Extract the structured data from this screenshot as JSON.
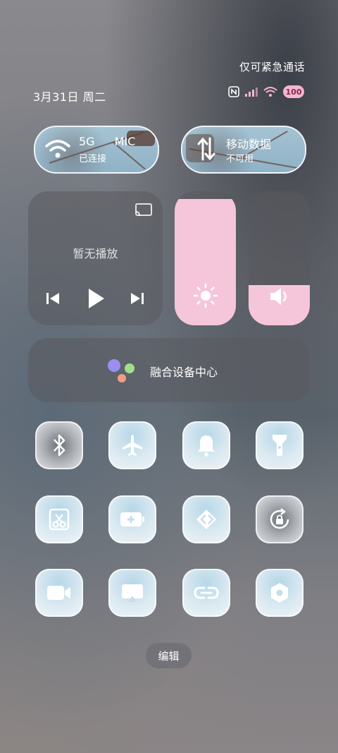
{
  "status_bar": {
    "emergency_text": "仅可紧急通话",
    "date": "3月31日 周二",
    "battery_text": "100"
  },
  "wifi_tile": {
    "label": "5G",
    "extra": "MIC",
    "sub": "已连接"
  },
  "data_tile": {
    "label": "移动数据",
    "sub": "不可用"
  },
  "media": {
    "title": "暂无播放"
  },
  "brightness": {
    "level": 0.94
  },
  "volume": {
    "level": 0.3
  },
  "fusion": {
    "label": "融合设备中心"
  },
  "toggles": [
    {
      "name": "bluetooth",
      "active": true
    },
    {
      "name": "airplane",
      "active": false
    },
    {
      "name": "bell",
      "active": false
    },
    {
      "name": "flashlight",
      "active": false
    },
    {
      "name": "screenshot",
      "active": false
    },
    {
      "name": "battery-saver",
      "active": false
    },
    {
      "name": "nearby-share",
      "active": false
    },
    {
      "name": "rotation-lock",
      "active": true
    },
    {
      "name": "screen-record",
      "active": false
    },
    {
      "name": "cast",
      "active": false
    },
    {
      "name": "link",
      "active": false
    },
    {
      "name": "settings",
      "active": false
    }
  ],
  "edit_button": {
    "label": "编辑"
  },
  "colors": {
    "accent_pink": "#f5c6d9",
    "tile_blue": "#b6d7e8",
    "tile_icon": "#ffffff"
  }
}
